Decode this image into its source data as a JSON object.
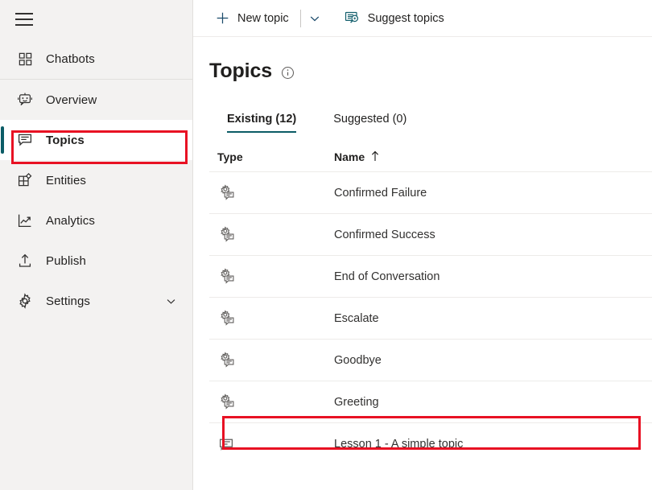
{
  "sidebar": {
    "menu_toggle": "hamburger-menu",
    "items": [
      {
        "label": "Chatbots",
        "icon": "grid-icon"
      },
      {
        "label": "Overview",
        "icon": "bot-icon"
      },
      {
        "label": "Topics",
        "icon": "speech-bubble-icon"
      },
      {
        "label": "Entities",
        "icon": "entities-grid-icon"
      },
      {
        "label": "Analytics",
        "icon": "line-chart-icon"
      },
      {
        "label": "Publish",
        "icon": "upload-icon"
      },
      {
        "label": "Settings",
        "icon": "gear-icon"
      }
    ],
    "selected": "Topics",
    "settings_expand_icon": "chevron-down-icon",
    "accent_color": "#0b5c66",
    "background": "#f3f2f1"
  },
  "command_bar": {
    "new_topic": {
      "label": "New topic",
      "icon": "plus-icon"
    },
    "new_topic_caret": "chevron-down-icon",
    "suggest_topics": {
      "label": "Suggest topics",
      "icon": "suggest-topics-icon"
    }
  },
  "page": {
    "title": "Topics",
    "info_icon": "info-circle-icon"
  },
  "tabs": [
    {
      "label": "Existing (12)",
      "active": true
    },
    {
      "label": "Suggested (0)",
      "active": false
    }
  ],
  "table": {
    "columns": [
      {
        "key": "type",
        "label": "Type"
      },
      {
        "key": "name",
        "label": "Name",
        "sort": "ascending",
        "sort_icon": "arrow-up-icon"
      }
    ],
    "rows": [
      {
        "type_icon": "system-topic-icon",
        "name": "Confirmed Failure"
      },
      {
        "type_icon": "system-topic-icon",
        "name": "Confirmed Success"
      },
      {
        "type_icon": "system-topic-icon",
        "name": "End of Conversation"
      },
      {
        "type_icon": "system-topic-icon",
        "name": "Escalate"
      },
      {
        "type_icon": "system-topic-icon",
        "name": "Goodbye"
      },
      {
        "type_icon": "system-topic-icon",
        "name": "Greeting",
        "highlighted": true
      },
      {
        "type_icon": "user-topic-icon",
        "name": "Lesson 1 - A simple topic"
      }
    ]
  },
  "annotations": {
    "highlight_color": "#e81123",
    "boxes": [
      {
        "target": "sidebar-item-topics"
      },
      {
        "target": "table-row-greeting"
      }
    ]
  }
}
